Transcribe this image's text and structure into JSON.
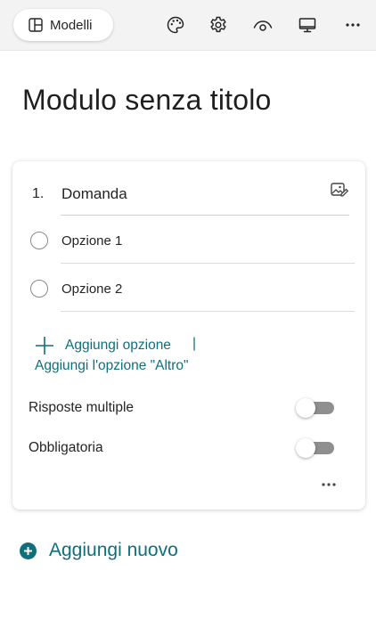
{
  "toolbar": {
    "templates_label": "Modelli",
    "icons": [
      "palette-icon",
      "gear-icon",
      "eye-icon",
      "present-icon",
      "more-icon"
    ]
  },
  "form": {
    "title": "Modulo senza titolo"
  },
  "question": {
    "number": "1.",
    "text": "Domanda",
    "options": [
      {
        "label": "Opzione 1"
      },
      {
        "label": "Opzione 2"
      }
    ],
    "add_option": "Aggiungi opzione",
    "separator": "|",
    "add_other": "Aggiungi l'opzione \"Altro\"",
    "multiple_answers": {
      "label": "Risposte multiple",
      "on": false
    },
    "required": {
      "label": "Obbligatoria",
      "on": false
    }
  },
  "add_new_label": "Aggiungi nuovo",
  "colors": {
    "accent": "#0f6f7a",
    "toggle_off": "#8f8f8f",
    "topbar": "#f3f3f3"
  }
}
